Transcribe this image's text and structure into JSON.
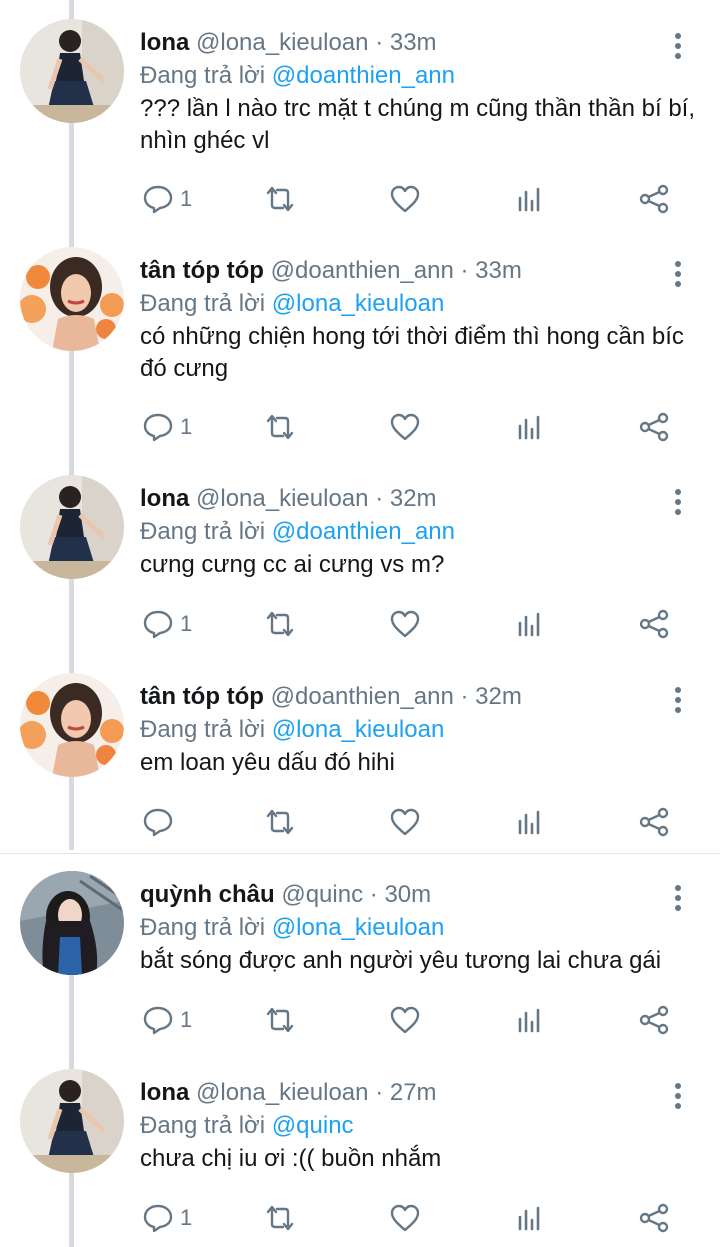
{
  "tweets": [
    {
      "name": "lona",
      "handle": "@lona_kieuloan",
      "dot": "·",
      "time": "33m",
      "reply_prefix": "Đang trả lời",
      "reply_to": "@doanthien_ann",
      "text": "??? lần l nào trc mặt t chúng m cũng thần thần bí bí, nhìn ghéc vl",
      "reply_count": "1",
      "avatar": "lona"
    },
    {
      "name": "tân tóp tóp",
      "handle": "@doanthien_ann",
      "dot": "·",
      "time": "33m",
      "reply_prefix": "Đang trả lời",
      "reply_to": "@lona_kieuloan",
      "text": "có những chiện hong tới thời điểm thì hong cần bíc đó cưng",
      "reply_count": "1",
      "avatar": "tan"
    },
    {
      "name": "lona",
      "handle": "@lona_kieuloan",
      "dot": "·",
      "time": "32m",
      "reply_prefix": "Đang trả lời",
      "reply_to": "@doanthien_ann",
      "text": "cưng cưng cc ai cưng vs m?",
      "reply_count": "1",
      "avatar": "lona"
    },
    {
      "name": "tân tóp tóp",
      "handle": "@doanthien_ann",
      "dot": "·",
      "time": "32m",
      "reply_prefix": "Đang trả lời",
      "reply_to": "@lona_kieuloan",
      "text": "em loan yêu dấu đó hihi",
      "reply_count": "",
      "avatar": "tan"
    },
    {
      "name": "quỳnh châu",
      "handle": "@quinc",
      "dot": "·",
      "time": "30m",
      "reply_prefix": "Đang trả lời",
      "reply_to": "@lona_kieuloan",
      "text": "bắt sóng được anh người yêu tương lai chưa gái",
      "reply_count": "1",
      "avatar": "quinc"
    },
    {
      "name": "lona",
      "handle": "@lona_kieuloan",
      "dot": "·",
      "time": "27m",
      "reply_prefix": "Đang trả lời",
      "reply_to": "@quinc",
      "text": "chưa chị iu ơi :(( buồn nhắm",
      "reply_count": "1",
      "avatar": "lona"
    }
  ],
  "icons": {
    "reply": "reply-icon",
    "retweet": "retweet-icon",
    "like": "heart-icon",
    "stats": "stats-icon",
    "share": "share-icon",
    "more": "more-vertical-icon"
  },
  "colors": {
    "link": "#1da1f2",
    "secondary_text": "#657786",
    "thread_line": "#d7dbdf"
  }
}
